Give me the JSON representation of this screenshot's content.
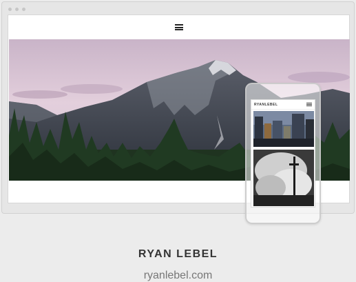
{
  "site": {
    "title": "RYAN LEBEL",
    "url": "ryanlebel.com",
    "mobile_logo": "RYANLEBEL"
  },
  "icons": {
    "menu": "hamburger-menu-icon",
    "window_controls": "window-dots-icon"
  },
  "colors": {
    "sky_top": "#d7c4d3",
    "mountain": "#3f4550",
    "forest": "#233b24",
    "caption": "#333333",
    "url": "#777777"
  }
}
